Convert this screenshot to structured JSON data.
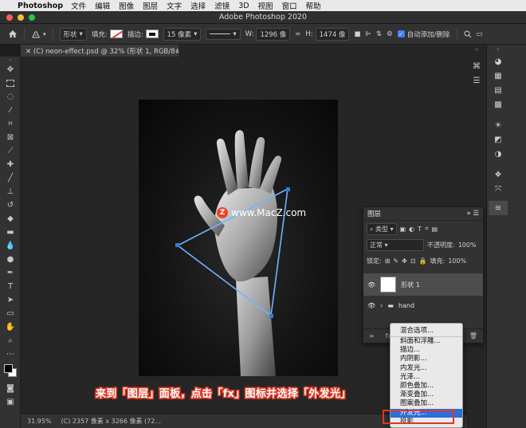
{
  "menubar": {
    "app_name": "Photoshop",
    "items": [
      "文件",
      "编辑",
      "图像",
      "图层",
      "文字",
      "选择",
      "滤镜",
      "3D",
      "视图",
      "窗口",
      "帮助"
    ]
  },
  "window": {
    "title": "Adobe Photoshop 2020"
  },
  "options": {
    "shape_mode": "形状",
    "fill_label": "填充:",
    "stroke_label": "描边:",
    "stroke_width": "15 像素",
    "w_label": "W:",
    "w_value": "1296 像",
    "h_label": "H:",
    "h_value": "1474 像",
    "auto_add_label": "自动添加/删除"
  },
  "document": {
    "tab_title": "(C) neon-effect.psd @ 32% (形状 1, RGB/8#) *",
    "zoom": "31.95%",
    "size_info": "(C) 2357 像素 x 3266 像素 (72..."
  },
  "watermark": {
    "logo": "Z",
    "text": "www.MacZ.com"
  },
  "layers_panel": {
    "title": "图层",
    "filter_kind": "类型",
    "blend_mode": "正常",
    "opacity_label": "不透明度:",
    "opacity_value": "100%",
    "lock_label": "锁定:",
    "fill_label": "填充:",
    "fill_value": "100%",
    "layers": [
      {
        "name": "形状 1",
        "selected": true
      },
      {
        "name": "hand",
        "selected": false
      }
    ]
  },
  "fx_menu": {
    "items": [
      "混合选项...",
      "斜面和浮雕...",
      "描边...",
      "内阴影...",
      "内发光...",
      "光泽...",
      "颜色叠加...",
      "渐变叠加...",
      "图案叠加...",
      "外发光...",
      "投影..."
    ],
    "highlighted": "外发光..."
  },
  "caption": "来到「图层」面板，点击「fx」图标并选择「外发光」",
  "colors": {
    "accent": "#2c6fd8",
    "caption_outline": "#e23b24",
    "path": "#6fb3ff"
  }
}
